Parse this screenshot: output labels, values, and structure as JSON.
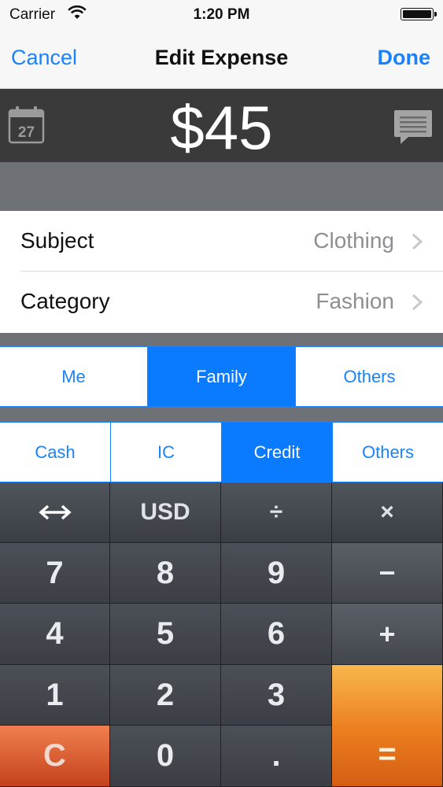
{
  "status_bar": {
    "carrier": "Carrier",
    "time": "1:20 PM",
    "wifi_icon": "wifi-icon",
    "battery_icon": "battery-icon"
  },
  "nav": {
    "cancel_label": "Cancel",
    "title": "Edit Expense",
    "done_label": "Done",
    "accent_color": "#1a82fb"
  },
  "amount_bar": {
    "calendar_day": "27",
    "amount": "$45",
    "calendar_icon": "calendar-icon",
    "note_icon": "note-bubble-icon"
  },
  "details": {
    "rows": [
      {
        "label": "Subject",
        "value": "Clothing"
      },
      {
        "label": "Category",
        "value": "Fashion"
      }
    ]
  },
  "payer_segment": {
    "options": [
      "Me",
      "Family",
      "Others"
    ],
    "selected": "Family"
  },
  "payment_segment": {
    "options": [
      "Cash",
      "IC",
      "Credit",
      "Others"
    ],
    "selected": "Credit"
  },
  "keypad": {
    "swap_icon": "swap-arrows-icon",
    "currency": "USD",
    "divide": "÷",
    "multiply": "×",
    "digits": [
      "7",
      "8",
      "9",
      "4",
      "5",
      "6",
      "1",
      "2",
      "3",
      "0"
    ],
    "minus": "−",
    "plus": "+",
    "clear": "C",
    "decimal": ".",
    "equals": "=",
    "equals_color": "#ec7d1f",
    "clear_color": "#e05a2e"
  }
}
